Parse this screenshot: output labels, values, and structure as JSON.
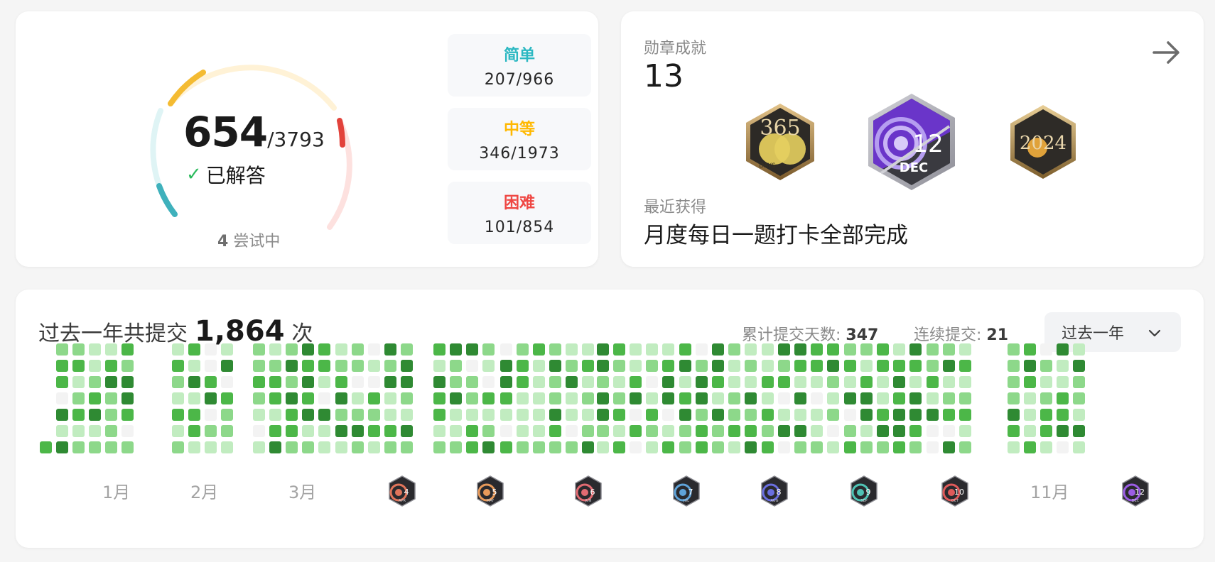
{
  "progress": {
    "solved": "654",
    "total": "/3793",
    "solved_label": "已解答",
    "attempting_count": "4",
    "attempting_label": "尝试中",
    "difficulties": [
      {
        "label": "简单",
        "value": "207/966",
        "color": "#2cb8c2"
      },
      {
        "label": "中等",
        "value": "346/1973",
        "color": "#ffb800"
      },
      {
        "label": "困难",
        "value": "101/854",
        "color": "#ef4743"
      }
    ]
  },
  "badges": {
    "title": "勋章成就",
    "count": "13",
    "items": [
      {
        "name": "365 Days",
        "caption_top": "365",
        "caption_bottom": "DAYS"
      },
      {
        "name": "Dec 12",
        "caption_top": "12",
        "caption_bottom": "DEC"
      },
      {
        "name": "2024",
        "caption_top": "2024",
        "caption_bottom": ""
      }
    ],
    "recent_label": "最近获得",
    "recent_name": "月度每日一题打卡全部完成"
  },
  "submissions": {
    "prefix": "过去一年共提交",
    "count": "1,864",
    "suffix": "次",
    "total_days_label": "累计提交天数:",
    "total_days": "347",
    "streak_label": "连续提交:",
    "streak": "21",
    "range": "过去一年",
    "month_labels": [
      "1月",
      "2月",
      "3月",
      "11月"
    ],
    "month_badges": [
      {
        "num": "4",
        "abbr": "APR",
        "color": "#e0745a"
      },
      {
        "num": "5",
        "abbr": "MAY",
        "color": "#e89a5a"
      },
      {
        "num": "6",
        "abbr": "JUN",
        "color": "#e26b72"
      },
      {
        "num": "7",
        "abbr": "JUL",
        "color": "#5fa3d9"
      },
      {
        "num": "8",
        "abbr": "AUG",
        "color": "#6a6fe0"
      },
      {
        "num": "9",
        "abbr": "SEP",
        "color": "#4fc3b5"
      },
      {
        "num": "10",
        "abbr": "OCT",
        "color": "#e05a5a"
      },
      {
        "num": "12",
        "abbr": "DEC",
        "color": "#9b5de5"
      }
    ]
  },
  "colors": {
    "empty": "#f3f3f3",
    "level1": "#c1ecc0",
    "level2": "#8dd88a",
    "level3": "#4cb748",
    "level4": "#2f8a33"
  }
}
